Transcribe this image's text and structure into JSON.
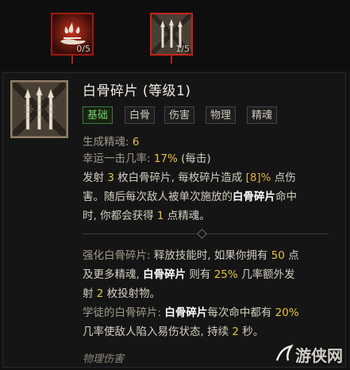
{
  "skill_bar": {
    "slots": [
      {
        "name": "blood-skill",
        "rank": "0/5"
      },
      {
        "name": "bone-splinters",
        "rank": "1/5"
      }
    ]
  },
  "tooltip": {
    "title": "白骨碎片 (等级1)",
    "tags": [
      "基础",
      "白骨",
      "伤害",
      "物理",
      "精魂"
    ],
    "generate_label": "生成精魂: ",
    "generate_value": "6",
    "lucky_label": "幸运一击几率: ",
    "lucky_value": "17%",
    "lucky_suffix": " (每击)",
    "desc_1a": "发射 ",
    "desc_1b": "3",
    "desc_1c": " 枚白骨碎片, 每枚碎片造成 ",
    "desc_1d": "[8]%",
    "desc_1e": " 点伤",
    "desc_2a": "害。随后每次敌人被单次施放的",
    "desc_2b": "白骨碎片",
    "desc_2c": "命中",
    "desc_3a": "时, 你都会获得 ",
    "desc_3b": "1",
    "desc_3c": " 点精魂。",
    "enh_label": "强化白骨碎片: ",
    "enh_1a": "释放技能时, 如果你拥有 ",
    "enh_1b": "50",
    "enh_1c": " 点",
    "enh_2a": "及更多精魂, ",
    "enh_2b": "白骨碎片",
    "enh_2c": " 则有 ",
    "enh_2d": "25%",
    "enh_2e": " 几率额外发",
    "enh_3a": "射 ",
    "enh_3b": "2",
    "enh_3c": " 枚投射物。",
    "app_label": "学徒的白骨碎片: ",
    "app_1a": "白骨碎片",
    "app_1b": "每次命中都有 ",
    "app_1c": "20%",
    "app_2a": "几率使敌人陷入易伤状态, 持续 ",
    "app_2b": "2",
    "app_2c": " 秒。",
    "footer": "物理伤害"
  },
  "watermark": "游侠网",
  "colors": {
    "accent_red": "#c8231a",
    "tag_green": "#6fd26a",
    "number_yellow": "#e7c244"
  }
}
